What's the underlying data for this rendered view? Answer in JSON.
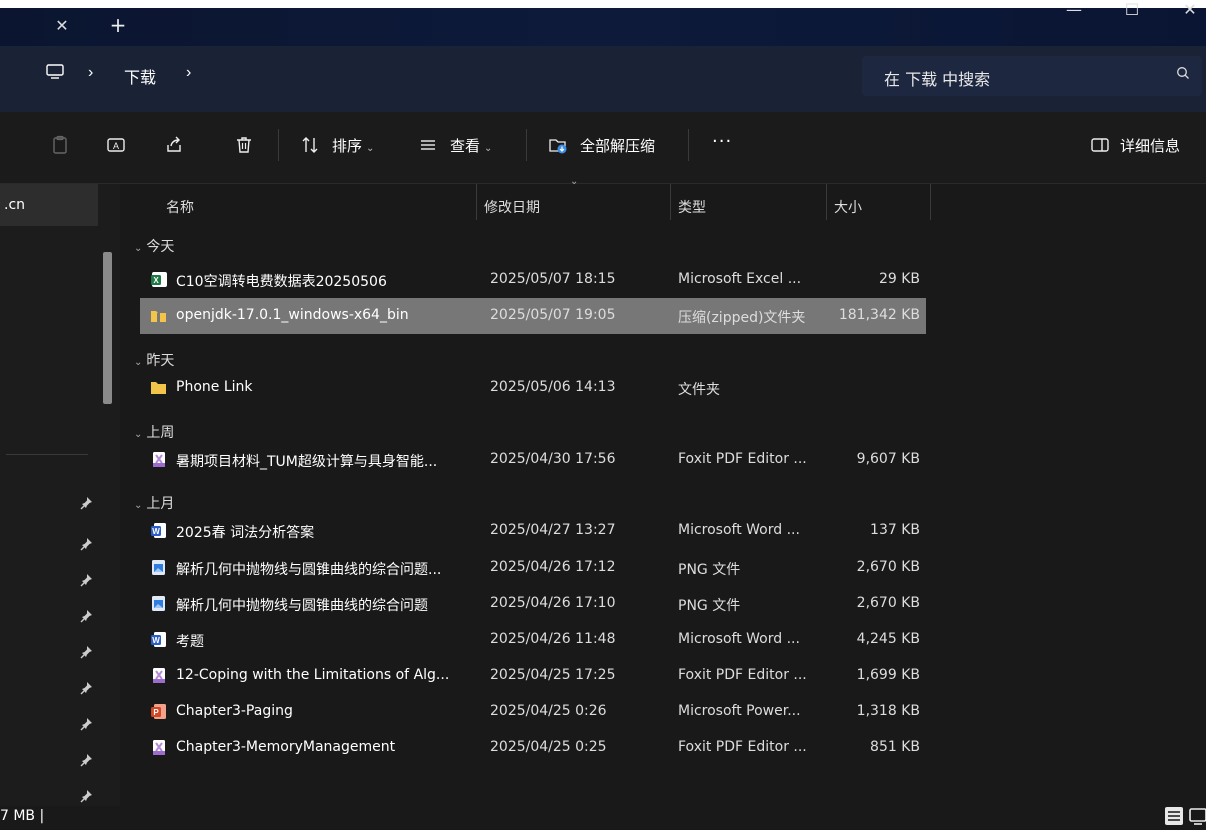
{
  "window": {
    "tab_close_glyph": "✕",
    "tab_new_glyph": "+",
    "min_glyph": "—",
    "max_glyph": "☐",
    "close_glyph": "✕"
  },
  "address": {
    "sep1": "›",
    "folder": "下载",
    "sep2": "›",
    "search_placeholder": "在 下载 中搜索"
  },
  "toolbar": {
    "sort_label": "排序",
    "view_label": "查看",
    "extract_label": "全部解压缩",
    "more_label": "···",
    "details_label": "详细信息",
    "chevron": "⌄"
  },
  "nav": {
    "selected_label": ".cn"
  },
  "columns": {
    "name": "名称",
    "date": "修改日期",
    "type": "类型",
    "size": "大小",
    "sort_indicator": "⌄"
  },
  "groups": [
    {
      "label": "今天"
    },
    {
      "label": "昨天"
    },
    {
      "label": "上周"
    },
    {
      "label": "上月"
    }
  ],
  "files": [
    {
      "name": "C10空调转电费数据表20250506",
      "date": "2025/05/07 18:15",
      "type": "Microsoft Excel ...",
      "size": "29 KB",
      "icon": "excel-icon",
      "selected": false
    },
    {
      "name": "openjdk-17.0.1_windows-x64_bin",
      "date": "2025/05/07 19:05",
      "type": "压缩(zipped)文件夹",
      "size": "181,342 KB",
      "icon": "zip-folder-icon",
      "selected": true
    },
    {
      "name": "Phone Link",
      "date": "2025/05/06 14:13",
      "type": "文件夹",
      "size": "",
      "icon": "folder-icon",
      "selected": false
    },
    {
      "name": "暑期项目材料_TUM超级计算与具身智能...",
      "date": "2025/04/30 17:56",
      "type": "Foxit PDF Editor ...",
      "size": "9,607 KB",
      "icon": "pdf-icon",
      "selected": false
    },
    {
      "name": "2025春 词法分析答案",
      "date": "2025/04/27 13:27",
      "type": "Microsoft Word ...",
      "size": "137 KB",
      "icon": "word-icon",
      "selected": false
    },
    {
      "name": "解析几何中抛物线与圆锥曲线的综合问题...",
      "date": "2025/04/26 17:12",
      "type": "PNG 文件",
      "size": "2,670 KB",
      "icon": "png-icon",
      "selected": false
    },
    {
      "name": "解析几何中抛物线与圆锥曲线的综合问题",
      "date": "2025/04/26 17:10",
      "type": "PNG 文件",
      "size": "2,670 KB",
      "icon": "png-icon",
      "selected": false
    },
    {
      "name": "考题",
      "date": "2025/04/26 11:48",
      "type": "Microsoft Word ...",
      "size": "4,245 KB",
      "icon": "word-icon",
      "selected": false
    },
    {
      "name": "12-Coping with the Limitations of Alg...",
      "date": "2025/04/25 17:25",
      "type": "Foxit PDF Editor ...",
      "size": "1,699 KB",
      "icon": "pdf-icon",
      "selected": false
    },
    {
      "name": "Chapter3-Paging",
      "date": "2025/04/25 0:26",
      "type": "Microsoft Power...",
      "size": "1,318 KB",
      "icon": "powerpoint-icon",
      "selected": false
    },
    {
      "name": "Chapter3-MemoryManagement",
      "date": "2025/04/25 0:25",
      "type": "Foxit PDF Editor ...",
      "size": "851 KB",
      "icon": "pdf-icon",
      "selected": false
    }
  ],
  "status": {
    "text": "7 MB  |"
  },
  "colors": {
    "selection": "#777777",
    "background": "#191919",
    "excel": "#1d7a45",
    "word": "#2b5ec6",
    "powerpoint": "#d24726",
    "folder": "#f3c44a",
    "pdf": "#b58ad8"
  }
}
